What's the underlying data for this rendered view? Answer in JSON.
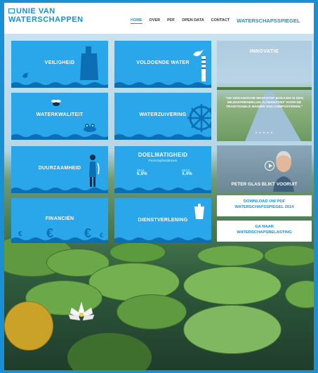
{
  "header": {
    "logo_line1": "UNIE VAN",
    "logo_line2": "WATERSCHAPPEN",
    "nav": [
      {
        "label": "HOME",
        "active": true
      },
      {
        "label": "OVER",
        "active": false
      },
      {
        "label": "PDF",
        "active": false
      },
      {
        "label": "OPEN DATA",
        "active": false
      },
      {
        "label": "CONTACT",
        "active": false
      }
    ],
    "brand": "WATERSCHAPSSPIEGEL"
  },
  "tiles": {
    "veiligheid": "VEILIGHEID",
    "voldoende_water": "VOLDOENDE WATER",
    "waterkwaliteit": "WATERKWALITEIT",
    "waterzuivering": "WATERZUIVERING",
    "duurzaamheid": "DUURZAAMHEID",
    "doelmatigheid": {
      "title": "DOELMATIGHEID",
      "subtitle": "Parenspheidenum",
      "col1_year": "2011",
      "col1_value": "6,8%",
      "col2_year": "2013",
      "col2_value": "4,4%"
    },
    "financien": "FINANCIËN",
    "dienstverlening": "DIENSTVERLENING"
  },
  "innovatie": {
    "title": "INNOVATIE",
    "quote": "\"DE ORGANISCHE MESTSTOF BOKASHI IS EEN MILIEUVRIENDELIJK ALTERNATIEF VOOR DE TRADITIONELE MANIER VAN COMPOSTEREN.\"",
    "dots": "● ● ● ● ●"
  },
  "video": {
    "caption": "PETER GLAS BLIKT VOORUIT"
  },
  "buttons": {
    "download_line1": "DOWNLOAD UW PDF",
    "download_line2": "WATERSCHAPSSPIEGEL 2014",
    "ganaar_line1": "GA NAAR",
    "ganaar_line2": "WATERSCHAPSBELASTING"
  },
  "colors": {
    "accent": "#1a8fd4",
    "tile": "#29a7ea",
    "wave_dark": "#0d6fb3"
  }
}
